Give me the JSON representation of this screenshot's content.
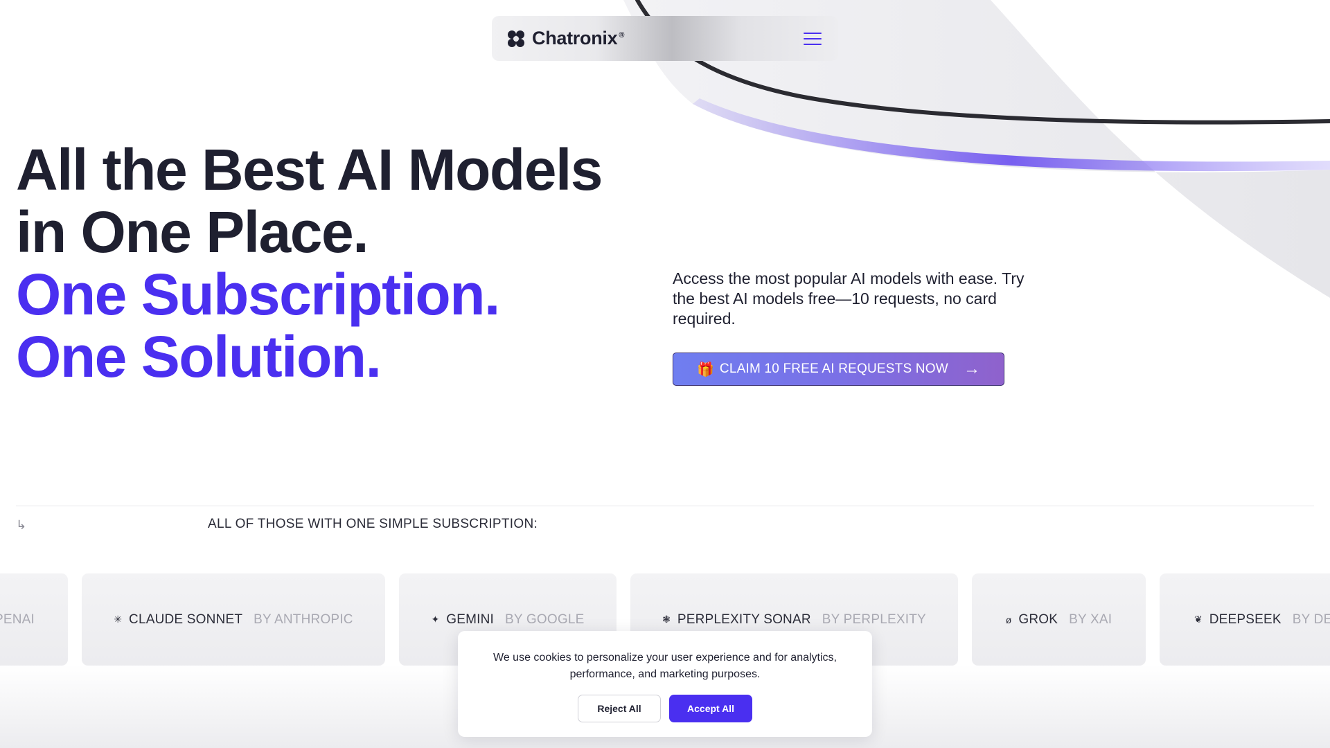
{
  "colors": {
    "accent": "#4a2ff0",
    "text": "#1f2030",
    "muted": "#a9a9b2"
  },
  "nav": {
    "brand_name": "Chatronix",
    "brand_reg": "®",
    "menu_icon": "hamburger-icon"
  },
  "hero": {
    "title_line1": "All the Best AI Models",
    "title_line2": "in One Place.",
    "accent_line1": "One Subscription.",
    "accent_line2": "One Solution.",
    "description": "Access the most popular AI models with ease. Try the best AI models free—10 requests, no card required.",
    "cta_label": "CLAIM 10 FREE AI REQUESTS NOW",
    "cta_gift": "🎁",
    "cta_arrow": "→"
  },
  "models_section": {
    "sub_arrow": "↳",
    "label": "ALL OF THOSE WITH ONE SIMPLE SUBSCRIPTION:",
    "models": [
      {
        "icon": "",
        "name": "",
        "by": "PENAI"
      },
      {
        "icon": "✳",
        "name": "CLAUDE SONNET",
        "by": "BY ANTHROPIC"
      },
      {
        "icon": "✦",
        "name": "GEMINI",
        "by": "BY GOOGLE"
      },
      {
        "icon": "❃",
        "name": "PERPLEXITY SONAR",
        "by": "BY PERPLEXITY"
      },
      {
        "icon": "ø",
        "name": "GROK",
        "by": "BY XAI"
      },
      {
        "icon": "❦",
        "name": "DEEPSEEK",
        "by": "BY DE"
      }
    ]
  },
  "cookie": {
    "text": "We use cookies to personalize your user experience and for analytics, performance, and marketing purposes.",
    "reject_label": "Reject All",
    "accept_label": "Accept All"
  }
}
